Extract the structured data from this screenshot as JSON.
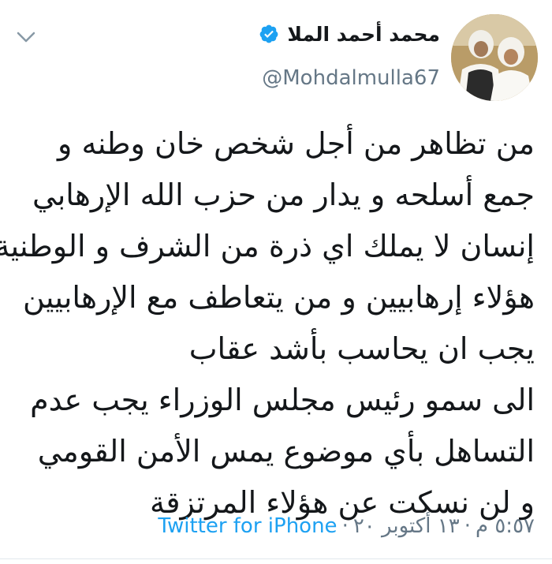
{
  "header": {
    "display_name": "محمد أحمد الملا",
    "handle": "@Mohdalmulla67",
    "verified": true,
    "avatar_icon": "user-avatar-photo",
    "menu_icon": "chevron-down-icon"
  },
  "tweet": {
    "lines": [
      "من تظاهر من أجل شخص خان وطنه و",
      "جمع أسلحه و يدار من حزب الله الإرهابي",
      "إنسان لا يملك اي ذرة من الشرف و الوطنية",
      "هؤلاء إرهابيين و من يتعاطف مع الإرهابيين",
      "يجب ان يحاسب بأشد عقاب",
      "الى سمو رئيس مجلس الوزراء يجب عدم",
      "التساهل بأي موضوع يمس الأمن القومي",
      "و لن نسكت عن هؤلاء المرتزقة"
    ]
  },
  "meta": {
    "time": "٥:٥٧ م",
    "separator": "·",
    "date": "١٣ أكتوبر ٢٠",
    "source": "Twitter for iPhone"
  },
  "colors": {
    "text": "#14171a",
    "secondary": "#657786",
    "link": "#1da1f2",
    "verified": "#1da1f2"
  }
}
